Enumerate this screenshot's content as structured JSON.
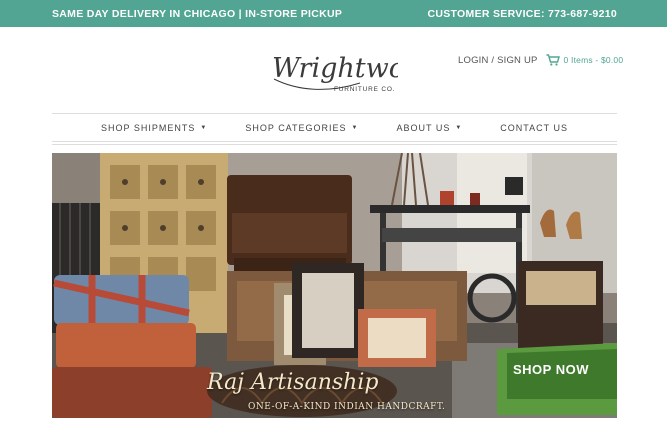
{
  "topbar": {
    "promo": "SAME DAY DELIVERY IN CHICAGO | IN-STORE PICKUP",
    "service": "CUSTOMER SERVICE: 773-687-9210"
  },
  "logo": {
    "name": "Wrightwood",
    "tagline": "FURNITURE CO."
  },
  "account": {
    "login": "LOGIN / SIGN UP",
    "cart": "0 Items - $0.00"
  },
  "nav": {
    "items": [
      {
        "label": "SHOP SHIPMENTS",
        "dropdown": true
      },
      {
        "label": "SHOP CATEGORIES",
        "dropdown": true
      },
      {
        "label": "ABOUT US",
        "dropdown": true
      },
      {
        "label": "CONTACT US",
        "dropdown": false
      }
    ]
  },
  "hero": {
    "title": "Raj Artisanship",
    "subtitle": "ONE-OF-A-KIND INDIAN HANDCRAFT.",
    "cta": "SHOP NOW"
  },
  "colors": {
    "accent": "#52a592",
    "background": "#ffffff",
    "hero_text": "#f4e8c8"
  },
  "icons": {
    "cart": "cart-icon",
    "caret": "caret-down-icon"
  }
}
